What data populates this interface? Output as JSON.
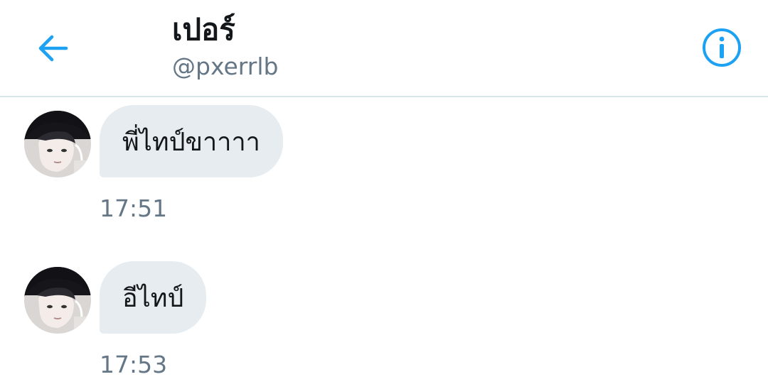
{
  "header": {
    "title": "เปอร์",
    "handle": "@pxerrlb",
    "back_icon": "arrow-left-icon",
    "info_icon": "info-circle-icon",
    "accent_color": "#1da1f2"
  },
  "messages": [
    {
      "text": "พี่ไทป์ขาาาา",
      "time": "17:51"
    },
    {
      "text": "อีไทป์",
      "time": "17:53"
    }
  ],
  "colors": {
    "bubble_bg": "#e6ecf0",
    "secondary_text": "#657786",
    "primary_text": "#14171a",
    "divider": "#d7e5ec"
  }
}
